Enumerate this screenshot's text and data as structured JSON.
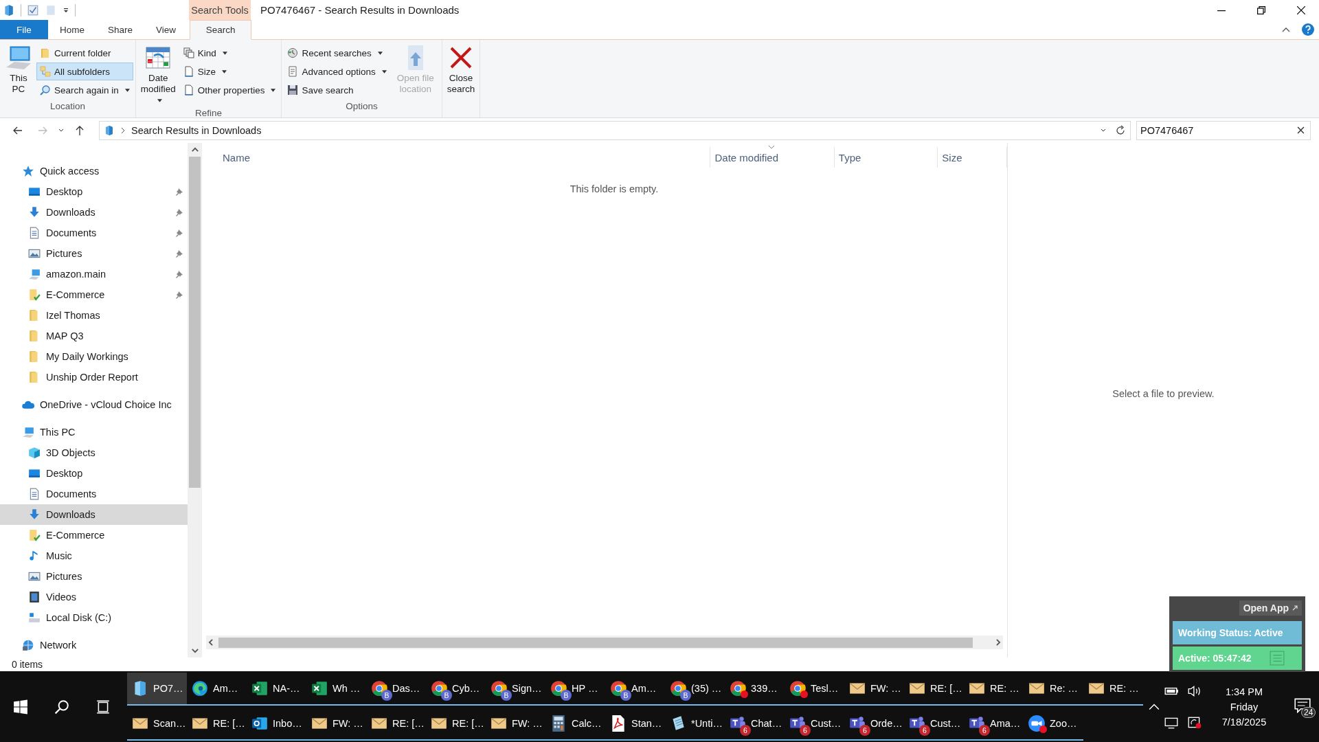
{
  "window": {
    "title": "PO7476467 - Search Results in Downloads",
    "context_label": "Search Tools"
  },
  "tabs": [
    {
      "label": "File",
      "kind": "file",
      "selected": false
    },
    {
      "label": "Home",
      "kind": "tab",
      "selected": false
    },
    {
      "label": "Share",
      "kind": "tab",
      "selected": false
    },
    {
      "label": "View",
      "kind": "tab",
      "selected": false
    },
    {
      "label": "Search",
      "kind": "context",
      "selected": true
    }
  ],
  "ribbon": [
    {
      "label": "Location",
      "items": [
        {
          "kind": "large",
          "label": "This PC",
          "dropdown": false,
          "disabled": false
        },
        {
          "kind": "small",
          "label": "Current folder",
          "selected": false,
          "dropdown": false
        },
        {
          "kind": "small",
          "label": "All subfolders",
          "selected": true,
          "dropdown": false
        },
        {
          "kind": "small",
          "label": "Search again in",
          "selected": false,
          "dropdown": true
        }
      ]
    },
    {
      "label": "Refine",
      "items": [
        {
          "kind": "large",
          "label": "Date modified",
          "dropdown": true,
          "disabled": false
        },
        {
          "kind": "small",
          "label": "Kind",
          "selected": false,
          "dropdown": true
        },
        {
          "kind": "small",
          "label": "Size",
          "selected": false,
          "dropdown": true
        },
        {
          "kind": "small",
          "label": "Other properties",
          "selected": false,
          "dropdown": true
        }
      ]
    },
    {
      "label": "Options",
      "items": [
        {
          "kind": "small",
          "label": "Recent searches",
          "selected": false,
          "dropdown": true
        },
        {
          "kind": "small",
          "label": "Advanced options",
          "selected": false,
          "dropdown": true
        },
        {
          "kind": "small",
          "label": "Save search",
          "selected": false,
          "dropdown": false
        },
        {
          "kind": "large",
          "label": "Open file location",
          "dropdown": false,
          "disabled": true
        }
      ]
    },
    {
      "items": [
        {
          "kind": "large",
          "label": "Close search",
          "dropdown": false,
          "disabled": false
        }
      ]
    }
  ],
  "address_bar": {
    "path": "Search Results in Downloads"
  },
  "search": {
    "value": "PO7476467"
  },
  "navigation": [
    {
      "label": "Quick access",
      "kind": "star",
      "selected": false,
      "children": [
        {
          "label": "Desktop",
          "kind": "desktop",
          "pinned": true,
          "selected": false
        },
        {
          "label": "Downloads",
          "kind": "download",
          "pinned": true,
          "selected": false
        },
        {
          "label": "Documents",
          "kind": "document",
          "pinned": true,
          "selected": false
        },
        {
          "label": "Pictures",
          "kind": "pictures",
          "pinned": true,
          "selected": false
        },
        {
          "label": "amazon.main",
          "kind": "computer",
          "pinned": true,
          "selected": false
        },
        {
          "label": "E-Commerce",
          "kind": "synced",
          "pinned": true,
          "selected": false
        },
        {
          "label": "Izel Thomas",
          "kind": "folder",
          "pinned": false,
          "selected": false
        },
        {
          "label": "MAP Q3",
          "kind": "folder",
          "pinned": false,
          "selected": false
        },
        {
          "label": "My Daily Workings",
          "kind": "folder",
          "pinned": false,
          "selected": false
        },
        {
          "label": "Unship Order Report",
          "kind": "folder",
          "pinned": false,
          "selected": false
        }
      ]
    },
    {
      "label": "OneDrive - vCloud Choice Inc",
      "kind": "cloud",
      "selected": false
    },
    {
      "label": "This PC",
      "kind": "pc",
      "selected": false,
      "children": [
        {
          "label": "3D Objects",
          "kind": "cube",
          "pinned": false,
          "selected": false
        },
        {
          "label": "Desktop",
          "kind": "desktop",
          "pinned": false,
          "selected": false
        },
        {
          "label": "Documents",
          "kind": "document",
          "pinned": false,
          "selected": false
        },
        {
          "label": "Downloads",
          "kind": "download",
          "pinned": false,
          "selected": true
        },
        {
          "label": "E-Commerce",
          "kind": "synced",
          "pinned": false,
          "selected": false
        },
        {
          "label": "Music",
          "kind": "music",
          "pinned": false,
          "selected": false
        },
        {
          "label": "Pictures",
          "kind": "pictures",
          "pinned": false,
          "selected": false
        },
        {
          "label": "Videos",
          "kind": "videos",
          "pinned": false,
          "selected": false
        },
        {
          "label": "Local Disk (C:)",
          "kind": "disk",
          "pinned": false,
          "selected": false
        }
      ]
    },
    {
      "label": "Network",
      "kind": "network",
      "selected": false
    }
  ],
  "file_list": {
    "columns": [
      {
        "label": "Name",
        "sorted": false
      },
      {
        "label": "Date modified",
        "sorted": true
      },
      {
        "label": "Type",
        "sorted": false
      },
      {
        "label": "Size",
        "sorted": false
      }
    ],
    "empty_message": "This folder is empty."
  },
  "preview_pane": {
    "message": "Select a file to preview."
  },
  "status_bar": {
    "item_count": "0 items"
  },
  "status_widget": {
    "open_button": "Open App",
    "status": "Working Status: Active",
    "timer": "Active: 05:47:42"
  },
  "taskbar": {
    "rows": [
      [
        {
          "label": "PO7…",
          "kind": "explorer",
          "selected": true
        },
        {
          "label": "Am…",
          "kind": "edge",
          "selected": false
        },
        {
          "label": "NA-…",
          "kind": "excel",
          "selected": false
        },
        {
          "label": "Wh …",
          "kind": "excel",
          "selected": false
        },
        {
          "label": "Das…",
          "kind": "chrome",
          "badge": "B",
          "selected": false
        },
        {
          "label": "Cyb…",
          "kind": "chrome",
          "badge": "B",
          "selected": false
        },
        {
          "label": "Sign…",
          "kind": "chrome",
          "badge": "B",
          "selected": false
        },
        {
          "label": "HP …",
          "kind": "chrome",
          "badge": "B",
          "selected": false
        },
        {
          "label": "Am…",
          "kind": "chrome",
          "badge": "B",
          "selected": false
        },
        {
          "label": "(35) …",
          "kind": "chrome",
          "badge": "B",
          "selected": false
        },
        {
          "label": "339…",
          "kind": "chrome",
          "alert": true,
          "selected": false
        },
        {
          "label": "Tesl…",
          "kind": "chrome",
          "alert": true,
          "selected": false
        },
        {
          "label": "FW: …",
          "kind": "mail",
          "selected": false
        },
        {
          "label": "RE: […",
          "kind": "mail",
          "selected": false
        },
        {
          "label": "RE: …",
          "kind": "mail",
          "selected": false
        },
        {
          "label": "Re: …",
          "kind": "mail",
          "selected": false
        },
        {
          "label": "RE: …",
          "kind": "mail",
          "selected": false
        }
      ],
      [
        {
          "label": "Scan…",
          "kind": "mail",
          "selected": false
        },
        {
          "label": "RE: […",
          "kind": "mail",
          "selected": false
        },
        {
          "label": "Inbo…",
          "kind": "outlook",
          "selected": false
        },
        {
          "label": "FW: …",
          "kind": "mail",
          "selected": false
        },
        {
          "label": "RE: […",
          "kind": "mail",
          "selected": false
        },
        {
          "label": "RE: […",
          "kind": "mail",
          "selected": false
        },
        {
          "label": "FW: …",
          "kind": "mail",
          "selected": false
        },
        {
          "label": "Calc…",
          "kind": "calculator",
          "selected": false
        },
        {
          "label": "Stan…",
          "kind": "pdf",
          "selected": false
        },
        {
          "label": "*Unti…",
          "kind": "notepad",
          "selected": false
        },
        {
          "label": "Chat…",
          "kind": "teams",
          "badge": "6",
          "selected": false
        },
        {
          "label": "Cust…",
          "kind": "teams",
          "badge": "6",
          "selected": false
        },
        {
          "label": "Orde…",
          "kind": "teams",
          "badge": "6",
          "selected": false
        },
        {
          "label": "Cust…",
          "kind": "teams",
          "badge": "6",
          "selected": false
        },
        {
          "label": "Ama…",
          "kind": "teams",
          "badge": "6",
          "selected": false
        },
        {
          "label": "Zoo…",
          "kind": "zoom",
          "alert": true,
          "selected": false
        }
      ]
    ],
    "clock": {
      "time": "1:34 PM",
      "day": "Friday",
      "date": "7/18/2025"
    },
    "notifications": "24"
  }
}
